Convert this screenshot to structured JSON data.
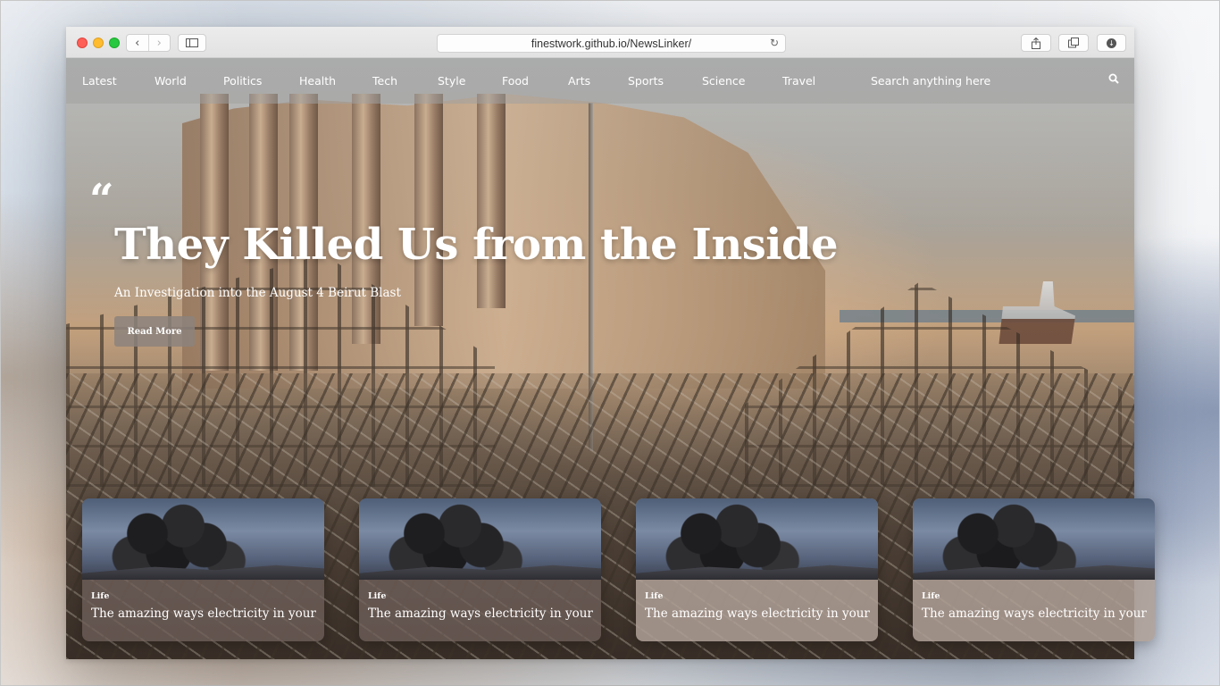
{
  "browser": {
    "url": "finestwork.github.io/NewsLinker/",
    "back_icon": "chevron-left-icon",
    "forward_icon": "chevron-right-icon",
    "sidebar_icon": "sidebar-icon",
    "reload_icon": "reload-icon",
    "share_icon": "share-icon",
    "tabs_icon": "tabs-icon",
    "download_icon": "download-icon"
  },
  "nav": {
    "items": [
      {
        "label": "Latest"
      },
      {
        "label": "World"
      },
      {
        "label": "Politics"
      },
      {
        "label": "Health"
      },
      {
        "label": "Tech"
      },
      {
        "label": "Style"
      },
      {
        "label": "Food"
      },
      {
        "label": "Arts"
      },
      {
        "label": "Sports"
      },
      {
        "label": "Science"
      },
      {
        "label": "Travel"
      }
    ],
    "search_placeholder": "Search anything here",
    "search_icon": "search-icon"
  },
  "hero": {
    "quote_mark": "“",
    "title": "They Killed Us from the Inside",
    "subtitle": "An Investigation into the August 4 Beirut Blast",
    "button_label": "Read More"
  },
  "cards": [
    {
      "tag": "Life",
      "title": "The amazing ways electricity in your"
    },
    {
      "tag": "Life",
      "title": "The amazing ways electricity in your"
    },
    {
      "tag": "Life",
      "title": "The amazing ways electricity in your"
    },
    {
      "tag": "Life",
      "title": "The amazing ways electricity in your"
    }
  ],
  "colors": {
    "traffic_red": "#fe5f57",
    "traffic_yellow": "#febc2e",
    "traffic_green": "#28c840",
    "nav_text": "#ffffff"
  }
}
